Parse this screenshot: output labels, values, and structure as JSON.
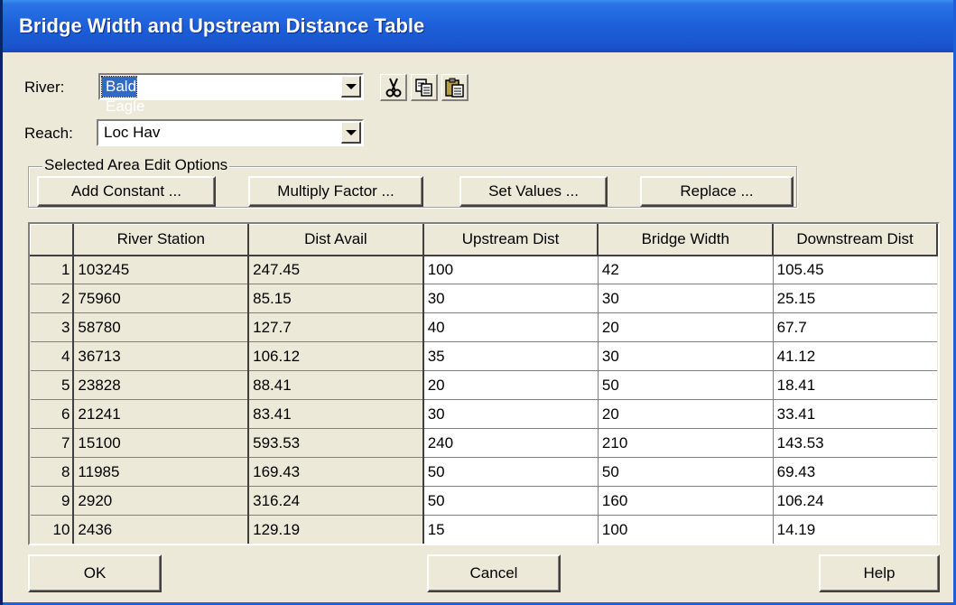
{
  "window": {
    "title": "Bridge Width and Upstream Distance Table"
  },
  "river": {
    "label": "River:",
    "value": "Bald Eagle"
  },
  "reach": {
    "label": "Reach:",
    "value": "Loc Hav"
  },
  "toolbar": {
    "cut_icon": "scissors-icon",
    "copy_icon": "copy-icon",
    "paste_icon": "paste-icon"
  },
  "edit_options": {
    "legend": "Selected Area Edit Options",
    "add_constant": "Add Constant ...",
    "multiply_factor": "Multiply Factor ...",
    "set_values": "Set Values ...",
    "replace": "Replace ..."
  },
  "table": {
    "columns": [
      "River Station",
      "Dist Avail",
      "Upstream Dist",
      "Bridge Width",
      "Downstream Dist"
    ],
    "rows": [
      {
        "n": "1",
        "station": "103245",
        "avail": "247.45",
        "upstream": "100",
        "width": "42",
        "downstream": "105.45"
      },
      {
        "n": "2",
        "station": "75960",
        "avail": "85.15",
        "upstream": "30",
        "width": "30",
        "downstream": "25.15"
      },
      {
        "n": "3",
        "station": "58780",
        "avail": "127.7",
        "upstream": "40",
        "width": "20",
        "downstream": "67.7"
      },
      {
        "n": "4",
        "station": "36713",
        "avail": "106.12",
        "upstream": "35",
        "width": "30",
        "downstream": "41.12"
      },
      {
        "n": "5",
        "station": "23828",
        "avail": "88.41",
        "upstream": "20",
        "width": "50",
        "downstream": "18.41"
      },
      {
        "n": "6",
        "station": "21241",
        "avail": "83.41",
        "upstream": "30",
        "width": "20",
        "downstream": "33.41"
      },
      {
        "n": "7",
        "station": "15100",
        "avail": "593.53",
        "upstream": "240",
        "width": "210",
        "downstream": "143.53"
      },
      {
        "n": "8",
        "station": "11985",
        "avail": "169.43",
        "upstream": "50",
        "width": "50",
        "downstream": "69.43"
      },
      {
        "n": "9",
        "station": "2920",
        "avail": "316.24",
        "upstream": "50",
        "width": "160",
        "downstream": "106.24"
      },
      {
        "n": "10",
        "station": "2436",
        "avail": "129.19",
        "upstream": "15",
        "width": "100",
        "downstream": "14.19"
      }
    ]
  },
  "buttons": {
    "ok": "OK",
    "cancel": "Cancel",
    "help": "Help"
  }
}
